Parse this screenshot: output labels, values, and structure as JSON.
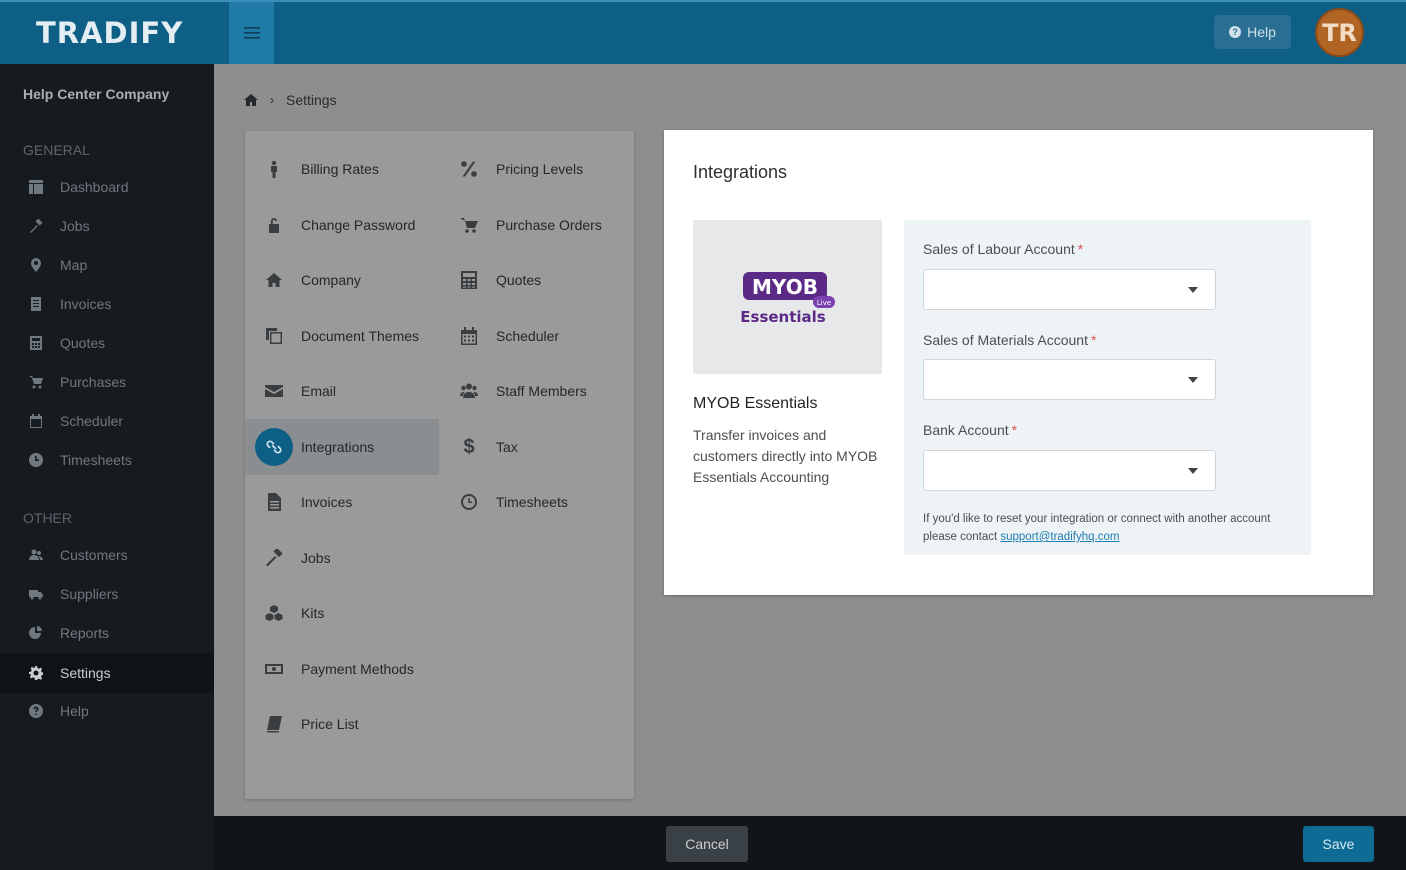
{
  "topbar": {
    "brand": "TRADIFY",
    "help_label": "Help",
    "avatar_initials": "TR"
  },
  "sidebar": {
    "company": "Help Center Company",
    "general_label": "GENERAL",
    "other_label": "OTHER",
    "general_items": [
      {
        "label": "Dashboard",
        "icon": "dashboard-icon"
      },
      {
        "label": "Jobs",
        "icon": "hammer-icon"
      },
      {
        "label": "Map",
        "icon": "map-pin-icon"
      },
      {
        "label": "Invoices",
        "icon": "invoice-icon"
      },
      {
        "label": "Quotes",
        "icon": "calculator-icon"
      },
      {
        "label": "Purchases",
        "icon": "cart-icon"
      },
      {
        "label": "Scheduler",
        "icon": "calendar-icon"
      },
      {
        "label": "Timesheets",
        "icon": "clock-icon"
      }
    ],
    "other_items": [
      {
        "label": "Customers",
        "icon": "users-icon"
      },
      {
        "label": "Suppliers",
        "icon": "truck-icon"
      },
      {
        "label": "Reports",
        "icon": "pie-chart-icon"
      },
      {
        "label": "Settings",
        "icon": "gear-icon",
        "active": true
      },
      {
        "label": "Help",
        "icon": "question-icon"
      }
    ]
  },
  "breadcrumb": {
    "current": "Settings"
  },
  "settings_menu": {
    "left": [
      {
        "label": "Billing Rates",
        "icon": "person-icon"
      },
      {
        "label": "Change Password",
        "icon": "lock-icon"
      },
      {
        "label": "Company",
        "icon": "home-icon"
      },
      {
        "label": "Document Themes",
        "icon": "copy-icon"
      },
      {
        "label": "Email",
        "icon": "envelope-icon"
      },
      {
        "label": "Integrations",
        "icon": "link-icon",
        "active": true
      },
      {
        "label": "Invoices",
        "icon": "document-icon"
      },
      {
        "label": "Jobs",
        "icon": "hammer-icon"
      },
      {
        "label": "Kits",
        "icon": "cubes-icon"
      },
      {
        "label": "Payment Methods",
        "icon": "money-icon"
      },
      {
        "label": "Price List",
        "icon": "book-icon"
      }
    ],
    "right": [
      {
        "label": "Pricing Levels",
        "icon": "percent-icon"
      },
      {
        "label": "Purchase Orders",
        "icon": "cart-icon"
      },
      {
        "label": "Quotes",
        "icon": "calculator-icon"
      },
      {
        "label": "Scheduler",
        "icon": "calendar-icon"
      },
      {
        "label": "Staff Members",
        "icon": "users-icon"
      },
      {
        "label": "Tax",
        "icon": "dollar-icon"
      },
      {
        "label": "Timesheets",
        "icon": "clock-icon"
      }
    ]
  },
  "panel": {
    "title": "Integrations",
    "logo_text_top": "MYOB",
    "logo_badge": "Live",
    "logo_text_bottom": "Essentials",
    "integration_name": "MYOB Essentials",
    "integration_desc": "Transfer invoices and customers directly into MYOB Essentials Accounting",
    "fields": [
      {
        "label": "Sales of Labour Account",
        "required": "*",
        "value": ""
      },
      {
        "label": "Sales of Materials Account",
        "required": "*",
        "value": ""
      },
      {
        "label": "Bank Account",
        "required": "*",
        "value": ""
      }
    ],
    "note_text": "If you'd like to reset your integration or connect with another account please contact ",
    "note_link": "support@tradifyhq.com"
  },
  "footer": {
    "cancel_label": "Cancel",
    "save_label": "Save"
  },
  "colors": {
    "topbar": "#0d5f86",
    "sidebar": "#161b1f",
    "accent": "#0d6b96",
    "logo_purple": "#5b2a86"
  }
}
